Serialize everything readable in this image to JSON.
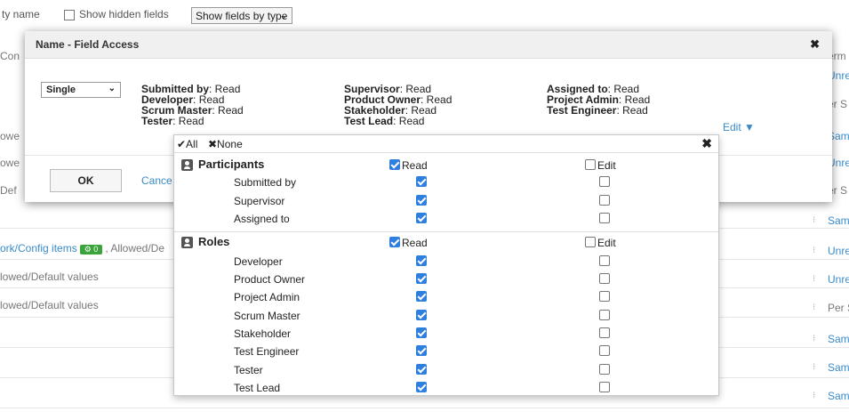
{
  "background": {
    "toolbar": {
      "label_partial": "ty name",
      "show_hidden_label": "Show hidden fields",
      "fields_select_value": "Show fields by type"
    },
    "left_fragments": [
      "Con",
      "owe",
      "owe",
      "Def"
    ],
    "row_texts": [
      "ork/Config items",
      "lowed/Default values",
      "lowed/Default values"
    ],
    "badge_text": "0",
    "row1_suffix": ", Allowed/De",
    "right_fragments": [
      "erm",
      "Unre",
      "er S",
      "Sam",
      "Unre",
      "er S",
      "Sam",
      "Unre",
      "Unre",
      "Per S",
      "Sam",
      "Sam",
      "Sam"
    ]
  },
  "dialog": {
    "title": "Name - Field Access",
    "close_icon": "close-icon",
    "mode_select_value": "Single",
    "permissions": [
      [
        {
          "role": "Submitted by",
          "value": ": Read"
        },
        {
          "role": "Developer",
          "value": ": Read"
        },
        {
          "role": "Scrum Master",
          "value": ": Read"
        },
        {
          "role": "Tester",
          "value": ": Read"
        }
      ],
      [
        {
          "role": "Supervisor",
          "value": ": Read"
        },
        {
          "role": "Product Owner",
          "value": ": Read"
        },
        {
          "role": "Stakeholder",
          "value": ": Read"
        },
        {
          "role": "Test Lead",
          "value": ": Read"
        }
      ],
      [
        {
          "role": "Assigned to",
          "value": ": Read"
        },
        {
          "role": "Project Admin",
          "value": ": Read"
        },
        {
          "role": "Test Engineer",
          "value": ": Read"
        }
      ]
    ],
    "edit_link": "Edit ▼",
    "ok_label": "OK",
    "cancel_label": "Cance"
  },
  "popover": {
    "all_label": "✔All",
    "none_label": "✖None",
    "close_icon": "close-icon",
    "read_header": "Read",
    "edit_header": "Edit",
    "groups": [
      {
        "title": "Participants",
        "icon": "person-icon",
        "items": [
          {
            "label": "Submitted by",
            "read": true,
            "edit": false
          },
          {
            "label": "Supervisor",
            "read": true,
            "edit": false
          },
          {
            "label": "Assigned to",
            "read": true,
            "edit": false
          }
        ]
      },
      {
        "title": "Roles",
        "icon": "role-card-icon",
        "items": [
          {
            "label": "Developer",
            "read": true,
            "edit": false
          },
          {
            "label": "Product Owner",
            "read": true,
            "edit": false
          },
          {
            "label": "Project Admin",
            "read": true,
            "edit": false
          },
          {
            "label": "Scrum Master",
            "read": true,
            "edit": false
          },
          {
            "label": "Stakeholder",
            "read": true,
            "edit": false
          },
          {
            "label": "Test Engineer",
            "read": true,
            "edit": false
          },
          {
            "label": "Tester",
            "read": true,
            "edit": false
          },
          {
            "label": "Test Lead",
            "read": true,
            "edit": false
          }
        ]
      }
    ]
  },
  "colors": {
    "accent": "#3a8bc9",
    "checkbox_on": "#2f7fdf",
    "badge": "#3aa43a"
  }
}
